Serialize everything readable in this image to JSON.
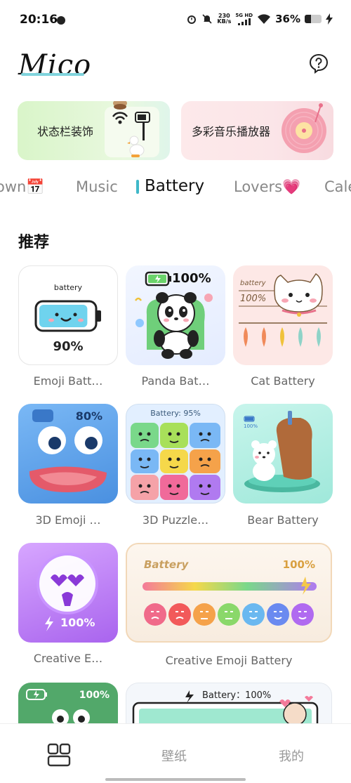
{
  "status_bar": {
    "time": "20:16",
    "speed_value": "230",
    "speed_unit": "KB/s",
    "network": "5G HD",
    "battery": "36%",
    "battery_level": 0.36
  },
  "header": {
    "logo": "Mico",
    "help_icon": "question-circle-icon"
  },
  "banners": [
    {
      "label": "状态栏装饰",
      "bg": "#dff5d0"
    },
    {
      "label": "多彩音乐播放器",
      "bg": "#fce6e8"
    }
  ],
  "tabs": [
    {
      "label": "own📅"
    },
    {
      "label": "Music"
    },
    {
      "label": "Battery",
      "active": true
    },
    {
      "label": "Lovers💗"
    },
    {
      "label": "Cale"
    }
  ],
  "section": {
    "title": "推荐"
  },
  "cards": [
    {
      "label": "Emoji Batt…",
      "thumb_text": "battery",
      "thumb_value": "90%",
      "battery_level": 0.9
    },
    {
      "label": "Panda Bat…",
      "thumb_value": "100%",
      "battery_level": 1.0
    },
    {
      "label": "Cat Battery",
      "thumb_text": "battery",
      "thumb_value": "100%",
      "battery_level": 1.0
    },
    {
      "label": "3D Emoji …",
      "thumb_value": "80%",
      "battery_level": 0.8
    },
    {
      "label": "3D Puzzle…",
      "thumb_text": "Battery: 95%",
      "battery_level": 0.95
    },
    {
      "label": "Bear Battery",
      "thumb_value": "100%",
      "battery_level": 1.0
    },
    {
      "label": "Creative E…",
      "thumb_value": "100%",
      "battery_level": 1.0
    },
    {
      "label": "Creative Emoji Battery",
      "thumb_text": "Battery",
      "thumb_value": "100%",
      "battery_level": 1.0
    },
    {
      "thumb_value": "100%",
      "battery_level": 1.0
    },
    {
      "thumb_text": "Battery：100%",
      "battery_level": 1.0
    }
  ],
  "bottom_nav": [
    {
      "label": "",
      "icon": "grid-icon",
      "active": true
    },
    {
      "label": "壁纸"
    },
    {
      "label": "我的"
    }
  ],
  "colors": {
    "accent": "#3fb8c9",
    "emoji_battery_fill": "#6fd3ee",
    "panda_bg": "#eaf1ff",
    "cat_bg": "#fde8e6",
    "emoji3d_bg": "#5aa7f0",
    "puzzle_bg": "#d9ecff",
    "bear_bg": "#b8f0e6",
    "creative_purple": "#b06ef0",
    "creative_wide_bg": "#fbf3ea",
    "frog_green": "#52a86a"
  }
}
